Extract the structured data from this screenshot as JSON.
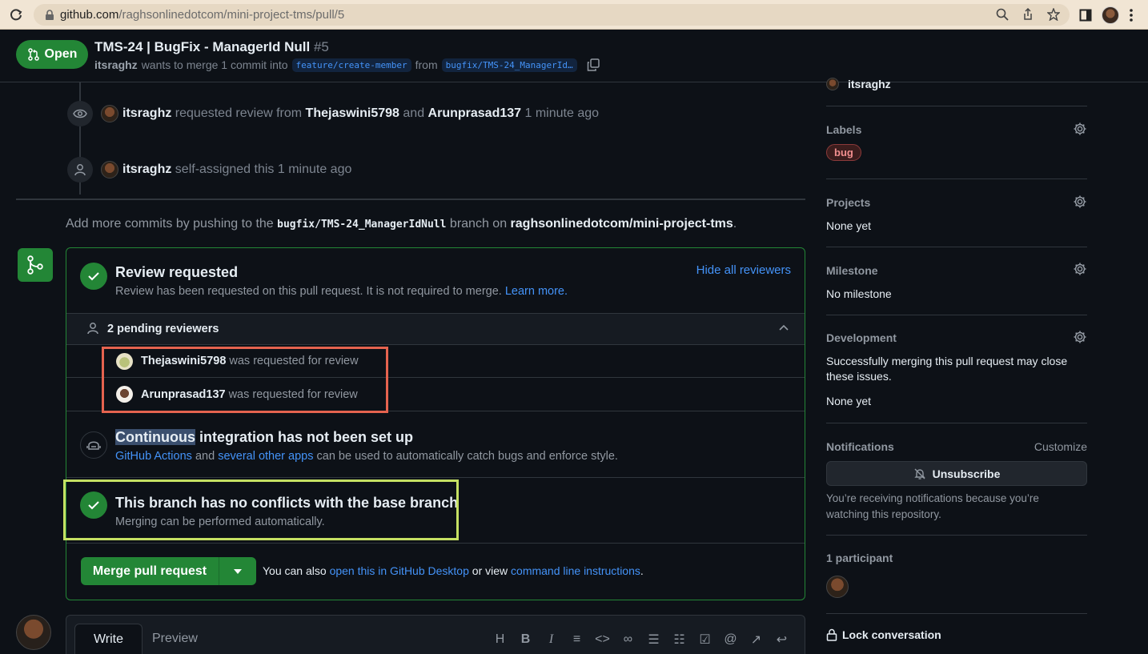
{
  "browser": {
    "url_host": "github.com",
    "url_path": "/raghsonlinedotcom/mini-project-tms/pull/5"
  },
  "pr": {
    "state": "Open",
    "title": "TMS-24 | BugFix - ManagerId Null",
    "number": "#5",
    "author": "itsraghz",
    "merge_text": "wants to merge 1 commit into",
    "base_branch": "feature/create-member",
    "from_text": "from",
    "head_branch": "bugfix/TMS-24_ManagerId…"
  },
  "timeline": {
    "item1": {
      "user": "itsraghz",
      "text1": "requested review from",
      "reviewer1": "Thejaswini5798",
      "and": "and",
      "reviewer2": "Arunprasad137",
      "time": "1 minute ago"
    },
    "item2": {
      "user": "itsraghz",
      "text": "self-assigned this 1 minute ago"
    }
  },
  "hint": {
    "prefix": "Add more commits by pushing to the",
    "branch": "bugfix/TMS-24_ManagerIdNull",
    "middle": "branch on",
    "repo": "raghsonlinedotcom/mini-project-tms",
    "suffix": "."
  },
  "merge_box": {
    "review": {
      "title": "Review requested",
      "subtitle": "Review has been requested on this pull request. It is not required to merge.",
      "learn_more": "Learn more.",
      "hide_reviewers": "Hide all reviewers"
    },
    "pending": {
      "label": "2 pending reviewers",
      "reviewers": [
        {
          "name": "Thejaswini5798",
          "status": "was requested for review"
        },
        {
          "name": "Arunprasad137",
          "status": "was requested for review"
        }
      ]
    },
    "ci": {
      "title_highlight": "Continuous",
      "title_rest": "integration has not been set up",
      "link1": "GitHub Actions",
      "and": "and",
      "link2": "several other apps",
      "rest": "can be used to automatically catch bugs and enforce style."
    },
    "conflicts": {
      "title": "This branch has no conflicts with the base branch",
      "subtitle": "Merging can be performed automatically."
    },
    "merge": {
      "button": "Merge pull request",
      "also": "You can also",
      "link1": "open this in GitHub Desktop",
      "or_view": "or view",
      "link2": "command line instructions",
      "end": "."
    }
  },
  "comment": {
    "tab_write": "Write",
    "tab_preview": "Preview"
  },
  "sidebar": {
    "assignee_partial": "itsraghz",
    "labels": {
      "heading": "Labels",
      "items": [
        "bug"
      ]
    },
    "projects": {
      "heading": "Projects",
      "value": "None yet"
    },
    "milestone": {
      "heading": "Milestone",
      "value": "No milestone"
    },
    "development": {
      "heading": "Development",
      "desc": "Successfully merging this pull request may close these issues.",
      "value": "None yet"
    },
    "notifications": {
      "heading": "Notifications",
      "customize": "Customize",
      "button": "Unsubscribe",
      "desc": "You’re receiving notifications because you’re watching this repository."
    },
    "participants": {
      "heading": "1 participant"
    },
    "lock": "Lock conversation"
  },
  "colors": {
    "accent_green": "#238636",
    "link_blue": "#4493f8",
    "highlight_red": "#e5634f",
    "highlight_green": "#c5e063"
  }
}
